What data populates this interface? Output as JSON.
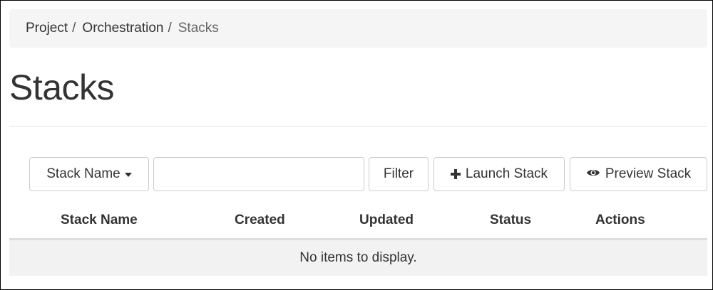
{
  "breadcrumb": {
    "items": [
      {
        "label": "Project",
        "sep": "/"
      },
      {
        "label": "Orchestration",
        "sep": "/"
      }
    ],
    "active": "Stacks"
  },
  "page": {
    "title": "Stacks"
  },
  "toolbar": {
    "filter_field_label": "Stack Name",
    "filter_input_value": "",
    "filter_button_label": "Filter",
    "launch_button_label": "Launch Stack",
    "launch_icon": "plus-icon",
    "preview_button_label": "Preview Stack",
    "preview_icon": "eye-icon"
  },
  "table": {
    "columns": [
      "Stack Name",
      "Created",
      "Updated",
      "Status",
      "Actions"
    ],
    "rows": [],
    "empty_message": "No items to display."
  },
  "colors": {
    "breadcrumb_bg": "#f5f5f5",
    "text": "#333333",
    "border": "#cccccc",
    "empty_row_bg": "#f2f2f2"
  }
}
